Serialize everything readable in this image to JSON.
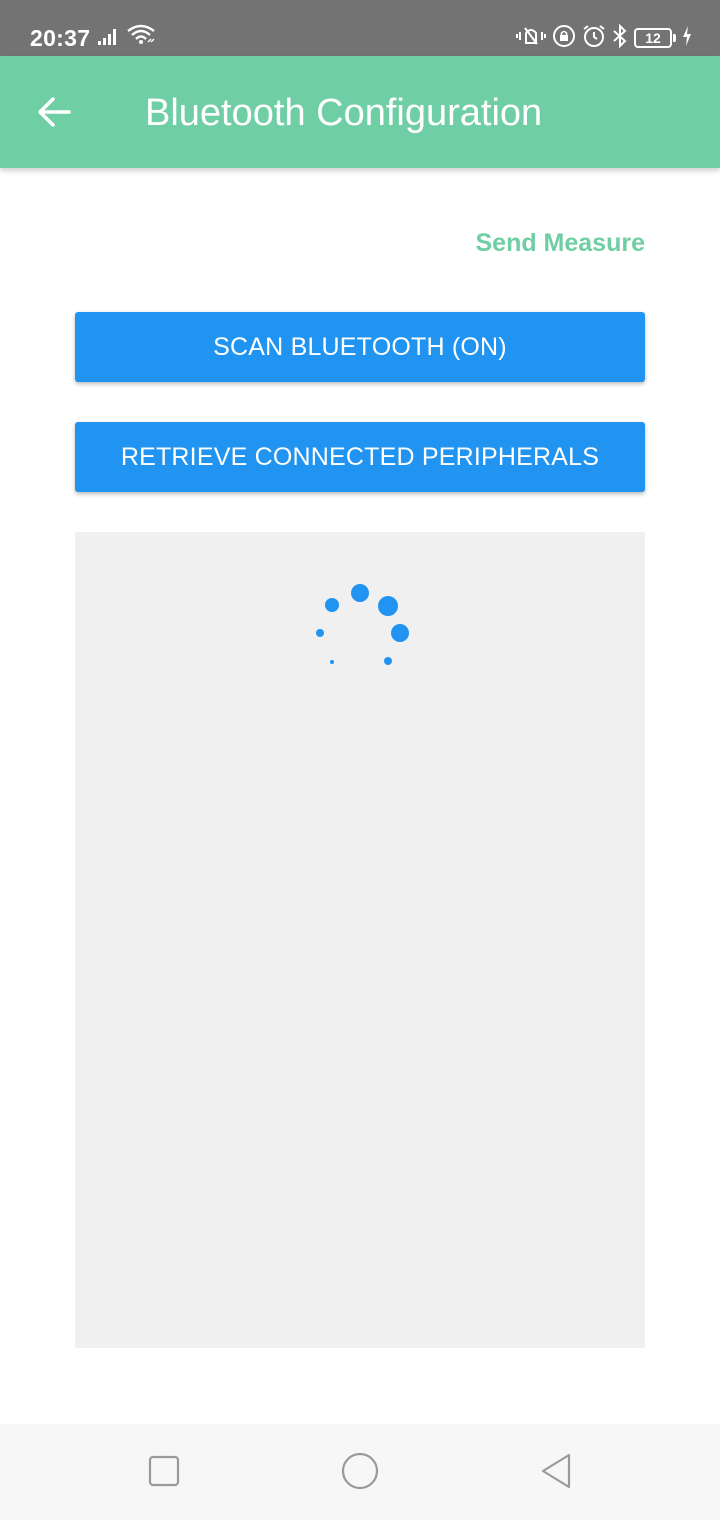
{
  "status_bar": {
    "time": "20:37",
    "battery_level": "12",
    "icons": [
      "signal-icon",
      "wifi-icon",
      "vibrate-icon",
      "rotation-lock-icon",
      "alarm-icon",
      "bluetooth-icon",
      "battery-icon",
      "charging-icon"
    ]
  },
  "app_bar": {
    "title": "Bluetooth Configuration",
    "back_icon": "arrow-left-icon"
  },
  "actions": {
    "send_measure": "Send Measure"
  },
  "buttons": {
    "scan": "SCAN BLUETOOTH (ON)",
    "retrieve": "RETRIEVE CONNECTED PERIPHERALS"
  },
  "results": {
    "loading": true
  },
  "nav_bar": {
    "icons": [
      "recent-apps-icon",
      "home-icon",
      "back-icon"
    ]
  },
  "colors": {
    "status_bar": "#737373",
    "app_bar": "#6fcea3",
    "accent_green": "#6fcea3",
    "button_blue": "#2193f0",
    "panel_bg": "#f0f0f0",
    "spinner": "#2193f0"
  }
}
